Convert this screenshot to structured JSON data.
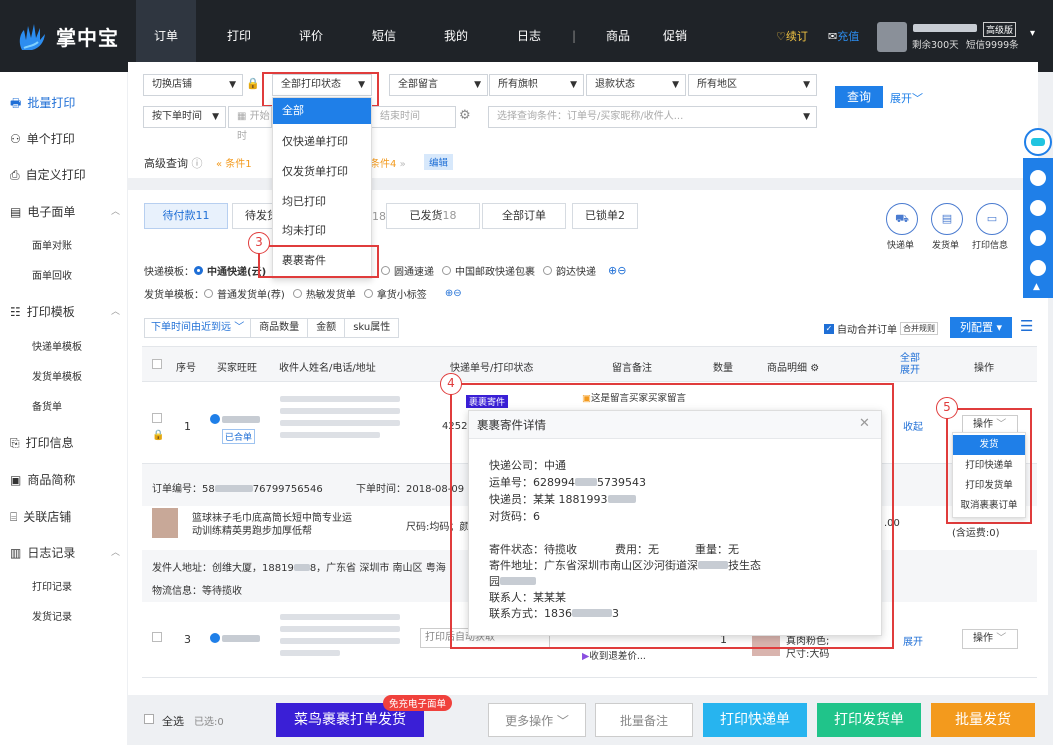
{
  "app": {
    "name": "掌中宝"
  },
  "topnav": {
    "items": [
      "订单",
      "打印",
      "评价",
      "短信",
      "我的",
      "日志",
      "|",
      "商品",
      "促销"
    ],
    "renew": "续订",
    "recharge": "充值",
    "edition": "高级版",
    "remaining": "剩余300天",
    "sms": "短信9999条"
  },
  "sidebar": {
    "batch_print": "批量打印",
    "single_print": "单个打印",
    "custom_print": "自定义打印",
    "eform": "电子面单",
    "eform_subs": [
      "面单对账",
      "面单回收"
    ],
    "print_template": "打印模板",
    "template_subs": [
      "快递单模板",
      "发货单模板",
      "备货单"
    ],
    "print_info": "打印信息",
    "product_short": "商品简称",
    "linked_shop": "关联店铺",
    "log": "日志记录",
    "log_subs": [
      "打印记录",
      "发货记录"
    ]
  },
  "filters": {
    "switch_shop": "切换店铺",
    "print_status": "全部打印状态",
    "all_message": "全部留言",
    "all_flags": "所有旗帜",
    "refund_status": "退款状态",
    "all_regions": "所有地区",
    "query": "查询",
    "expand": "展开",
    "order_time": "按下单时间",
    "start_time": "开始时",
    "end_time": "结束时间",
    "search_placeholder": "选择查询条件：订单号/买家昵称/收件人...",
    "advanced": "高级查询",
    "cond1": "条件1",
    "cond4": "条件4",
    "edit": "编辑"
  },
  "print_status_menu": {
    "items": [
      "全部",
      "仅快递单打印",
      "仅发货单打印",
      "均已打印",
      "均未打印",
      "裹裹寄件"
    ]
  },
  "tabs": [
    {
      "label": "待付款",
      "count": "11"
    },
    {
      "label": "待发货",
      "count": "18"
    },
    {
      "label": "已发货",
      "count": "18"
    },
    {
      "label": "全部订单",
      "count": ""
    },
    {
      "label": "已锁单",
      "count": "2"
    }
  ],
  "tab_partial": "18",
  "action_icons": [
    "快递单",
    "发货单",
    "打印信息"
  ],
  "express_template": {
    "label": "快递模板：",
    "options": [
      "中通快递(云)",
      "圆通速递",
      "中国邮政快递包裹",
      "韵达快递"
    ]
  },
  "ship_template": {
    "label": "发货单模板：",
    "options": [
      "普通发货单(荐)",
      "热敏发货单",
      "拿货小标签"
    ]
  },
  "sort": {
    "options": [
      "下单时间由近到远",
      "商品数量",
      "金额",
      "sku属性"
    ]
  },
  "auto_merge": "自动合并订单",
  "merge_rule": "合并规则",
  "column_config": "列配置",
  "table_headers": [
    "序号",
    "买家旺旺",
    "收件人姓名/电话/地址",
    "快递单号/打印状态",
    "留言备注",
    "数量",
    "商品明细",
    "全部展开",
    "操作"
  ],
  "row1": {
    "seq": "1",
    "merged": "已合单",
    "tracking_prefix": "4252",
    "tag": "裹裹寄件",
    "message": "这是留言买家买家留言",
    "collapse": "收起",
    "op": "操作"
  },
  "order_info": {
    "order_no": "订单编号：58",
    "order_no_tail": "76799756546",
    "order_time": "下单时间：2018-08-09 1",
    "product": "篮球袜子毛巾底高筒长短中筒专业运动训练精英男跑步加厚低帮",
    "sku": "尺码:均码；颜",
    "price": ".00",
    "shipping_note": "(含运费:0)",
    "sender_addr": "发件人地址：创维大厦，18819",
    "sender_addr_mid": "8，广东省 深圳市 南山区 粤海",
    "logistics": "物流信息：等待揽收"
  },
  "row3": {
    "seq": "3",
    "print_label": "打印后自动获取",
    "tag": "快递",
    "message": "收到退差价...",
    "qty": "1",
    "product": "真肉粉色;",
    "size": "尺寸:大码",
    "expand": "展开",
    "op": "操作"
  },
  "popup": {
    "title": "裹裹寄件详情",
    "courier_company": "快递公司：中通",
    "tracking_no_a": "运单号：628994",
    "tracking_no_b": "5739543",
    "courier": "快递员：某某 1881993",
    "pickup_code": "对货码：6",
    "status": "寄件状态：待揽收",
    "fee": "费用：无",
    "weight": "重量：无",
    "address": "寄件地址：广东省深圳市南山区沙河街道深",
    "address_tail": "技生态",
    "address_line2": "园",
    "contact": "联系人：某某某",
    "phone_a": "联系方式：1836",
    "phone_b": "3"
  },
  "op_menu": {
    "items": [
      "发货",
      "打印快递单",
      "打印发货单",
      "取消裹裹订单"
    ]
  },
  "annotations": [
    "3",
    "4",
    "5"
  ],
  "bottom": {
    "select_all": "全选",
    "selected": "已选:0",
    "cainiao": "菜鸟裹裹打单发货",
    "free_badge": "免充电子面单",
    "more_ops": "更多操作",
    "batch_note": "批量备注",
    "print_express": "打印快递单",
    "print_ship": "打印发货单",
    "batch_ship": "批量发货"
  },
  "colors": {
    "brand_blue": "#1f7fe8",
    "topbar": "#1f2328",
    "cainiao_purple": "#3a1fd6",
    "green": "#20c48a",
    "orange": "#f39a1d",
    "cyan": "#27b4ef",
    "annotation_red": "#e03c3c"
  }
}
